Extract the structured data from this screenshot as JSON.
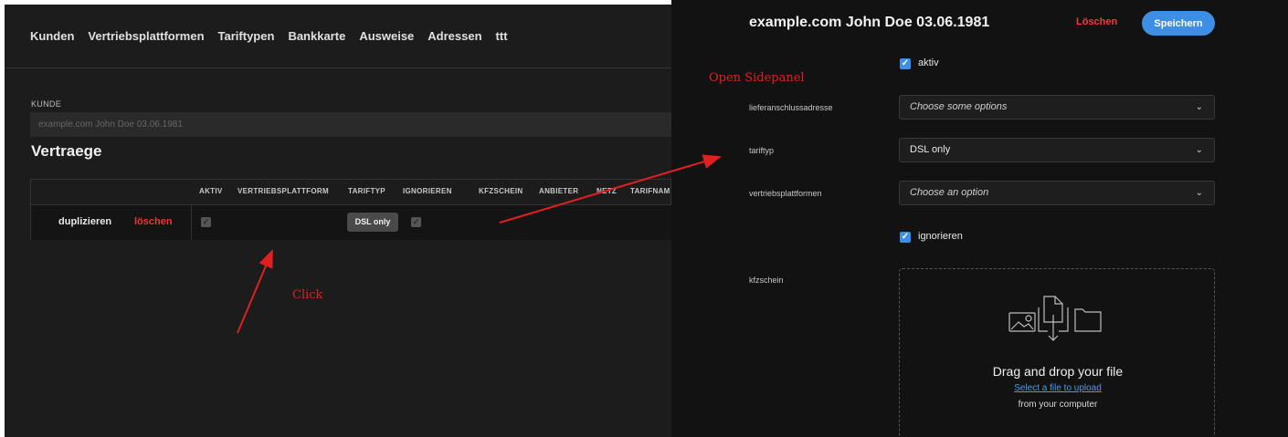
{
  "nav": {
    "items": [
      "Kunden",
      "Vertriebsplattformen",
      "Tariftypen",
      "Bankkarte",
      "Ausweise",
      "Adressen",
      "ttt"
    ]
  },
  "kunde": {
    "label": "KUNDE",
    "placeholder": "example.com John Doe 03.06.1981"
  },
  "vertraege": {
    "title": "Vertraege",
    "columns": [
      "AKTIV",
      "VERTRIEBSPLATTFORM",
      "TARIFTYP",
      "IGNORIEREN",
      "KFZSCHEIN",
      "ANBIETER",
      "NETZ",
      "TARIFNAM"
    ],
    "rows": [
      {
        "duplicate_label": "duplizieren",
        "delete_label": "löschen",
        "aktiv": true,
        "tariftyp": "DSL only",
        "ignorieren": true
      }
    ]
  },
  "panel": {
    "title": "example.com John Doe 03.06.1981",
    "delete_label": "Löschen",
    "save_label": "Speichern",
    "aktiv_label": "aktiv",
    "ignorieren_label": "ignorieren",
    "fields": {
      "lieferanschluss": {
        "label": "lieferanschlussadresse",
        "value": "Choose some options"
      },
      "tariftyp": {
        "label": "tariftyp",
        "value": "DSL only"
      },
      "vertriebsplattformen": {
        "label": "vertriebsplattformen",
        "value": "Choose an option"
      },
      "kfzschein": {
        "label": "kfzschein"
      }
    },
    "dropzone": {
      "title": "Drag and drop your file",
      "link": "Select a file to upload",
      "sub": "from your computer"
    }
  },
  "annotations": {
    "open_sidepanel": "Open Sidepanel",
    "click": "Click",
    "color": "#e02020"
  },
  "colors": {
    "accent": "#3d8fe6",
    "danger": "#e53935"
  }
}
